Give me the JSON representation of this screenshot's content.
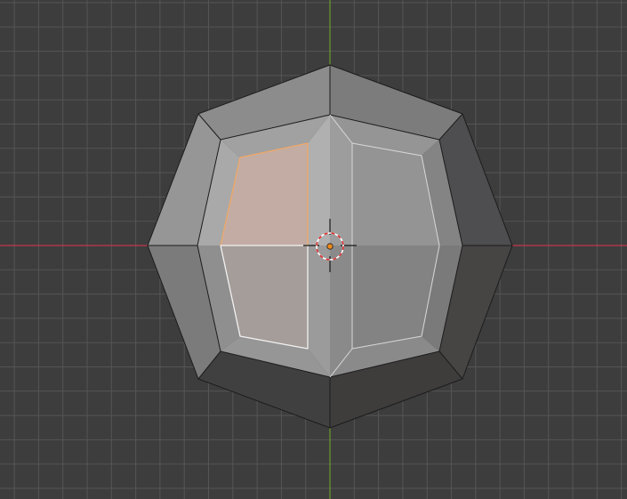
{
  "viewport": {
    "view": "front-orthographic",
    "mode": "edit-mode",
    "selection_mode": "face"
  },
  "colors": {
    "background": "#3d3d3d",
    "grid_minor": "#4a4a4a",
    "grid_major": "#555555",
    "x_axis": "#c23a4a",
    "z_axis": "#6a9a28",
    "mesh_edge": "#1a1a1a",
    "selected_edge": "#f2f2f2",
    "active_edge": "#f0a868",
    "selected_face_tint": "#e0a890",
    "origin_dot": "#f08a1c",
    "cursor_ring_red": "#e03030",
    "cursor_ring_white": "#ffffff"
  },
  "mesh": {
    "object": "bevelled-cube",
    "selected_faces": 2
  },
  "icons": {
    "cursor": "3d-cursor-icon",
    "origin": "object-origin-icon"
  }
}
